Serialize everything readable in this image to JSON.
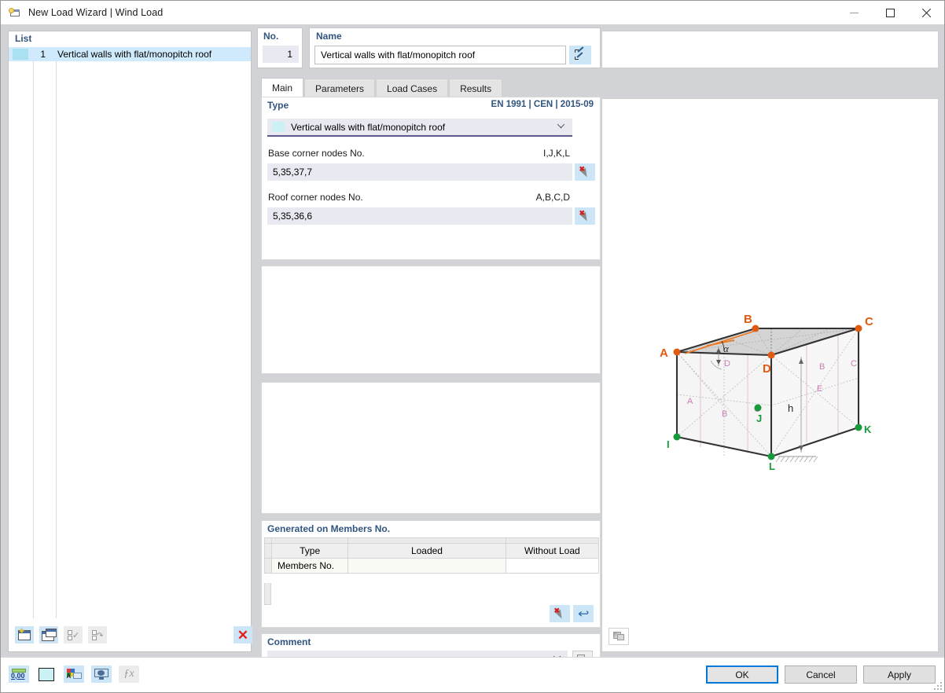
{
  "window": {
    "title": "New Load Wizard | Wind Load",
    "icon": "load-wizard-icon",
    "minimize_label": "Minimize",
    "maximize_label": "Maximize",
    "close_label": "Close"
  },
  "list": {
    "header": "List",
    "rows": [
      {
        "no": "1",
        "label": "Vertical walls with flat/monopitch roof"
      }
    ],
    "toolbar": [
      {
        "name": "new-load-case-button",
        "icon": "new-window-star-icon",
        "enabled": true
      },
      {
        "name": "copy-load-case-button",
        "icon": "copy-window-icon",
        "enabled": true
      },
      {
        "name": "select-all-button",
        "icon": "checkbox-check-icon",
        "enabled": false
      },
      {
        "name": "invert-selection-button",
        "icon": "checkbox-swap-icon",
        "enabled": false
      },
      {
        "name": "delete-button",
        "icon": "red-x-icon",
        "enabled": true,
        "glyph": "✕"
      }
    ]
  },
  "header": {
    "no_label": "No.",
    "no_value": "1",
    "name_label": "Name",
    "name_value": "Vertical walls with flat/monopitch roof",
    "name_edit_icon": "pencil-edit-icon"
  },
  "tabs": [
    {
      "label": "Main",
      "active": true
    },
    {
      "label": "Parameters",
      "active": false
    },
    {
      "label": "Load Cases",
      "active": false
    },
    {
      "label": "Results",
      "active": false
    }
  ],
  "type_section": {
    "title": "Type",
    "standard": "EN 1991 | CEN | 2015-09",
    "combo_value": "Vertical walls with flat/monopitch roof",
    "combo_icon": "chevron-down-icon",
    "base_nodes": {
      "label": "Base corner nodes No.",
      "hint": "I,J,K,L",
      "value": "5,35,37,7",
      "pick_icon": "pick-cursor-icon"
    },
    "roof_nodes": {
      "label": "Roof corner nodes No.",
      "hint": "A,B,C,D",
      "value": "5,35,36,6",
      "pick_icon": "pick-cursor-icon"
    }
  },
  "generated_section": {
    "title": "Generated on Members No.",
    "columns": [
      "Type",
      "Loaded",
      "Without Load"
    ],
    "rows": [
      {
        "type": "Members No.",
        "loaded": "",
        "without_load": ""
      }
    ],
    "buttons": [
      {
        "name": "pick-members-button",
        "icon": "pick-cursor-icon"
      },
      {
        "name": "reset-members-button",
        "icon": "undo-arrow-icon",
        "glyph": "↩"
      }
    ]
  },
  "comment_section": {
    "title": "Comment",
    "value": "",
    "placeholder": "",
    "dropdown_icon": "chevron-down-icon",
    "copy_icon": "copy-comment-icon"
  },
  "preview": {
    "image_button_icon": "picture-icon",
    "diagram": {
      "roof_corner_labels": [
        "A",
        "B",
        "C",
        "D"
      ],
      "base_corner_labels": [
        "I",
        "J",
        "K",
        "L"
      ],
      "zone_labels_front": [
        "A",
        "B",
        "C",
        "D"
      ],
      "zone_labels_side": [
        "B",
        "C",
        "E"
      ],
      "angle_label": "α",
      "height_label": "h",
      "roof_zone_label": "D",
      "roof_corner_color": "#e05a10",
      "base_corner_color": "#179a3c",
      "zone_text_color": "#cc7fb4",
      "ridge_line_color": "#ee7722"
    }
  },
  "status_toolbar": [
    {
      "name": "numeric-display-button",
      "icon": "ruler-000-icon",
      "enabled": true
    },
    {
      "name": "color-swatch-button",
      "icon": "cyan-swatch-icon",
      "enabled": true
    },
    {
      "name": "render-label-button",
      "icon": "color-label-icon",
      "enabled": true
    },
    {
      "name": "view-3d-button",
      "icon": "monitor-globe-icon",
      "enabled": true
    },
    {
      "name": "function-button",
      "icon": "fx-icon",
      "enabled": false,
      "glyph": "ƒx"
    }
  ],
  "dialog_buttons": [
    {
      "label": "OK",
      "primary": true
    },
    {
      "label": "Cancel",
      "primary": false
    },
    {
      "label": "Apply",
      "primary": false
    }
  ]
}
